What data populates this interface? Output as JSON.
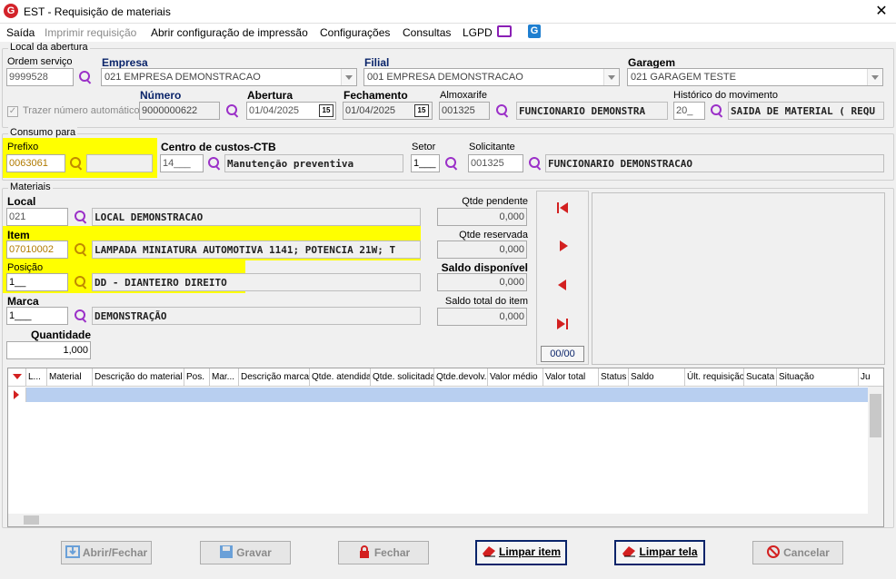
{
  "window": {
    "title": "EST - Requisição de materiais"
  },
  "menu": {
    "items": [
      "Saída",
      "Imprimir requisição",
      "Abrir configuração de impressão",
      "Configurações",
      "Consultas",
      "LGPD"
    ]
  },
  "abertura": {
    "group_title": "Local da abertura",
    "ordem_servico": {
      "label": "Ordem serviço",
      "value": "9999528"
    },
    "empresa": {
      "label": "Empresa",
      "value": "021 EMPRESA DEMONSTRACAO"
    },
    "filial": {
      "label": "Filial",
      "value": "001 EMPRESA DEMONSTRACAO"
    },
    "garagem": {
      "label": "Garagem",
      "value": "021 GARAGEM TESTE"
    },
    "trazer_numero": {
      "label": "Trazer número automático",
      "checked": true
    },
    "numero": {
      "label": "Número",
      "value": "9000000622"
    },
    "abertura": {
      "label": "Abertura",
      "value": "01/04/2025"
    },
    "fechamento": {
      "label": "Fechamento",
      "value": "01/04/2025"
    },
    "almoxarife": {
      "label": "Almoxarife",
      "code": "001325",
      "name": "FUNCIONARIO DEMONSTRA"
    },
    "historico": {
      "label": "Histórico do movimento",
      "code": "20_",
      "name": "SAIDA DE MATERIAL ( REQU"
    }
  },
  "consumo": {
    "group_title": "Consumo para",
    "prefixo": {
      "label": "Prefixo",
      "value": "0063061"
    },
    "centro_custos": {
      "label": "Centro de custos-CTB",
      "code": "14___",
      "name": "Manutenção preventiva"
    },
    "setor": {
      "label": "Setor",
      "value": "1___"
    },
    "solicitante": {
      "label": "Solicitante",
      "code": "001325",
      "name": "FUNCIONARIO DEMONSTRACAO"
    }
  },
  "materiais": {
    "group_title": "Materiais",
    "local": {
      "label": "Local",
      "code": "021",
      "name": "LOCAL DEMONSTRACAO"
    },
    "item": {
      "label": "Item",
      "code": "07010002",
      "name": "LAMPADA MINIATURA AUTOMOTIVA 1141; POTENCIA 21W; T"
    },
    "posicao": {
      "label": "Posição",
      "code": "1__",
      "name": "DD - DIANTEIRO DIREITO"
    },
    "marca": {
      "label": "Marca",
      "code": "1___",
      "name": "DEMONSTRAÇÃO"
    },
    "quantidade": {
      "label": "Quantidade",
      "value": "1,000"
    },
    "qtde_pendente": {
      "label": "Qtde pendente",
      "value": "0,000"
    },
    "qtde_reservada": {
      "label": "Qtde reservada",
      "value": "0,000"
    },
    "saldo_disponivel": {
      "label": "Saldo disponível",
      "value": "0,000"
    },
    "saldo_total": {
      "label": "Saldo total do item",
      "value": "0,000"
    },
    "counter": "00/00"
  },
  "grid": {
    "columns": [
      "L...",
      "Material",
      "Descrição do material",
      "Pos.",
      "Mar...",
      "Descrição marca",
      "Qtde. atendida",
      "Qtde. solicitada",
      "Qtde.devolv.",
      "Valor médio",
      "Valor total",
      "Status",
      "Saldo",
      "Últ. requisição",
      "Sucata",
      "Situação",
      "Ju"
    ]
  },
  "buttons": {
    "abrir_fechar": "Abrir/Fechar",
    "gravar": "Gravar",
    "fechar": "Fechar",
    "limpar_item": "Limpar item",
    "limpar_tela": "Limpar tela",
    "cancelar": "Cancelar"
  },
  "colors": {
    "highlight": "#ffff00",
    "accent": "#9b30c8",
    "navy": "#0a246a",
    "grid_selection": "#b8cff0"
  }
}
